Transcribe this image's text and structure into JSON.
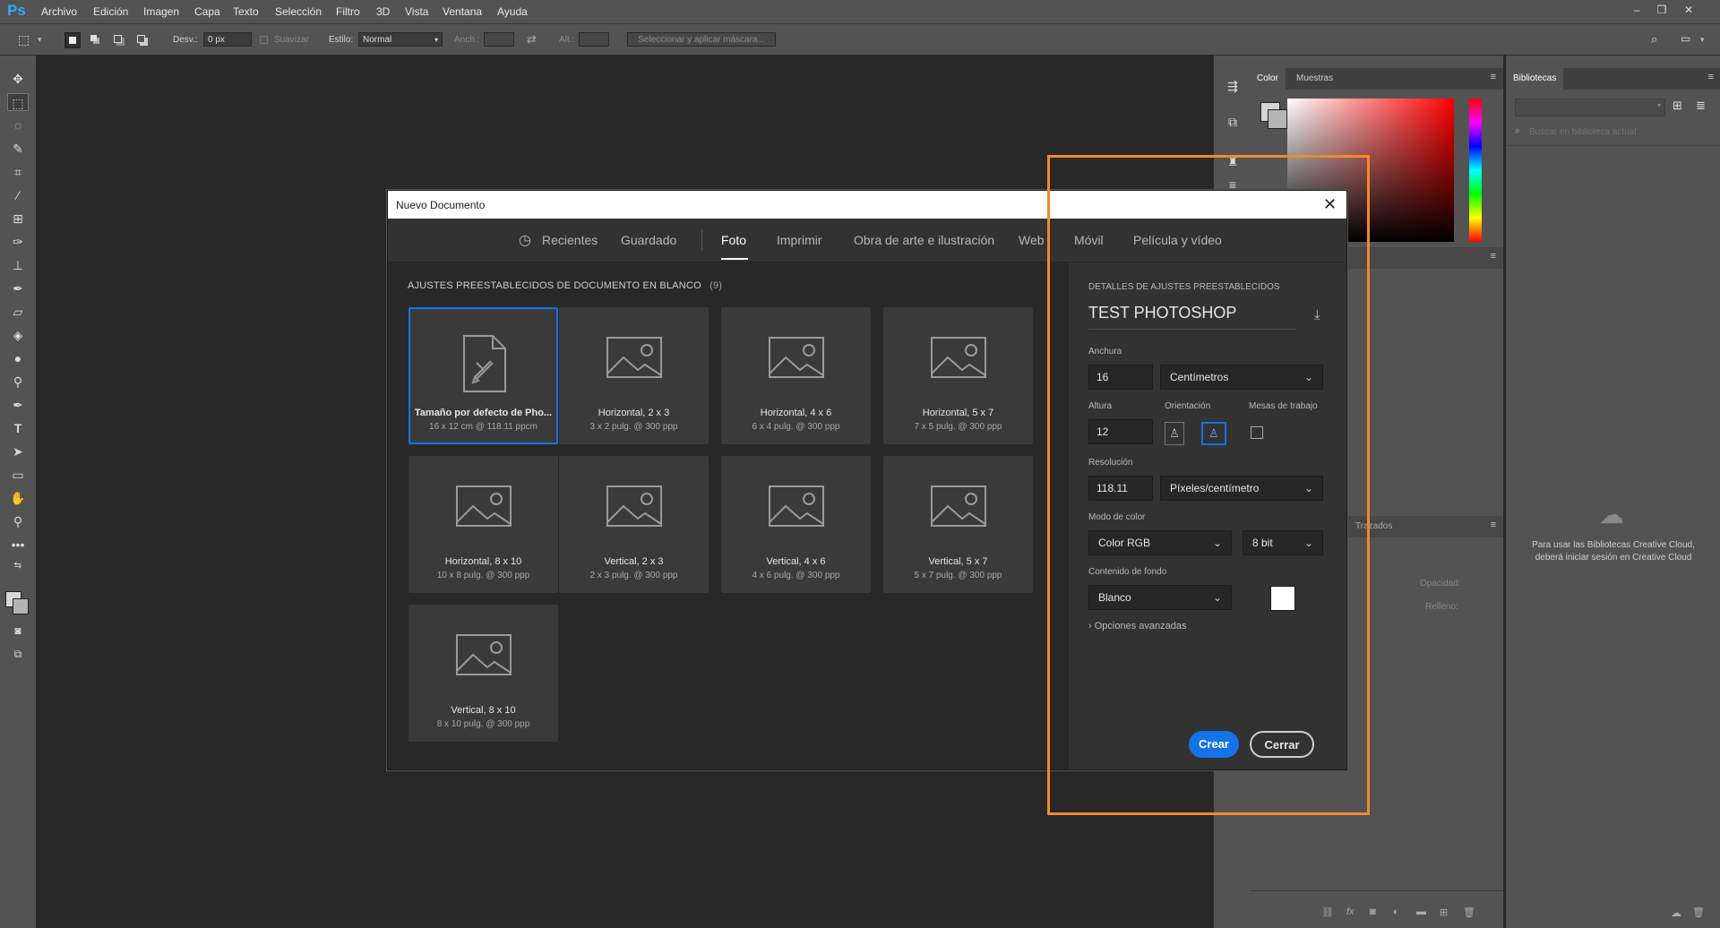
{
  "app": {
    "logo": "Ps",
    "menu": [
      "Archivo",
      "Edición",
      "Imagen",
      "Capa",
      "Texto",
      "Selección",
      "Filtro",
      "3D",
      "Vista",
      "Ventana",
      "Ayuda"
    ]
  },
  "options_bar": {
    "feather_label": "Desv.:",
    "feather_value": "0 px",
    "antialias_label": "Suavizar",
    "style_label": "Estilo:",
    "style_value": "Normal",
    "width_label": "Anch.:",
    "height_label": "Alt.:",
    "mask_button": "Seleccionar y aplicar máscara..."
  },
  "panels": {
    "color_tab": "Color",
    "swatches_tab": "Muestras",
    "libraries_tab": "Bibliotecas",
    "libraries_search_placeholder": "Buscar en biblioteca actual",
    "libraries_message": "Para usar las Bibliotecas Creative Cloud, deberá iniciar sesión en Creative Cloud",
    "paths_tab": "Trazados",
    "opacity_label": "Opacidad:",
    "fill_label": "Relleno:"
  },
  "dialog": {
    "title": "Nuevo Documento",
    "tabs": [
      {
        "label": "Recientes",
        "active": false
      },
      {
        "label": "Guardado",
        "active": false
      },
      {
        "label": "Foto",
        "active": true
      },
      {
        "label": "Imprimir",
        "active": false
      },
      {
        "label": "Obra de arte e ilustración",
        "active": false
      },
      {
        "label": "Web",
        "active": false
      },
      {
        "label": "Móvil",
        "active": false
      },
      {
        "label": "Película y vídeo",
        "active": false
      }
    ],
    "presets_heading": "AJUSTES PREESTABLECIDOS DE DOCUMENTO EN BLANCO",
    "presets_count": "(9)",
    "presets": [
      {
        "title": "Tamaño por defecto de Pho...",
        "sub": "16 x 12 cm @ 118.11 ppcm",
        "selected": true,
        "icon": "document-icon"
      },
      {
        "title": "Horizontal, 2 x 3",
        "sub": "3 x 2 pulg. @ 300 ppp",
        "selected": false,
        "icon": "image-icon"
      },
      {
        "title": "Horizontal, 4 x 6",
        "sub": "6 x 4 pulg. @ 300 ppp",
        "selected": false,
        "icon": "image-icon"
      },
      {
        "title": "Horizontal, 5 x 7",
        "sub": "7 x 5 pulg. @ 300 ppp",
        "selected": false,
        "icon": "image-icon"
      },
      {
        "title": "Horizontal, 8 x 10",
        "sub": "10 x 8 pulg. @ 300 ppp",
        "selected": false,
        "icon": "image-icon"
      },
      {
        "title": "Vertical, 2 x 3",
        "sub": "2 x 3 pulg. @ 300 ppp",
        "selected": false,
        "icon": "image-icon"
      },
      {
        "title": "Vertical, 4 x 6",
        "sub": "4 x 6 pulg. @ 300 ppp",
        "selected": false,
        "icon": "image-icon"
      },
      {
        "title": "Vertical, 5 x 7",
        "sub": "5 x 7 pulg. @ 300 ppp",
        "selected": false,
        "icon": "image-icon"
      },
      {
        "title": "Vertical, 8 x 10",
        "sub": "8 x 10 pulg. @ 300 ppp",
        "selected": false,
        "icon": "image-icon"
      }
    ],
    "details": {
      "heading": "DETALLES DE AJUSTES PREESTABLECIDOS",
      "name": "TEST PHOTOSHOP",
      "width_label": "Anchura",
      "width_value": "16",
      "width_unit": "Centímetros",
      "height_label": "Altura",
      "height_value": "12",
      "orientation_label": "Orientación",
      "artboards_label": "Mesas de trabajo",
      "resolution_label": "Resolución",
      "resolution_value": "118.11",
      "resolution_unit": "Píxeles/centímetro",
      "color_mode_label": "Modo de color",
      "color_mode_value": "Color RGB",
      "bit_depth_value": "8 bit",
      "background_label": "Contenido de fondo",
      "background_value": "Blanco",
      "background_swatch": "#ffffff",
      "advanced_label": "Opciones avanzadas",
      "create_button": "Crear",
      "close_button": "Cerrar"
    }
  },
  "colors": {
    "accent": "#1473e6",
    "highlight": "#f08a2c"
  }
}
